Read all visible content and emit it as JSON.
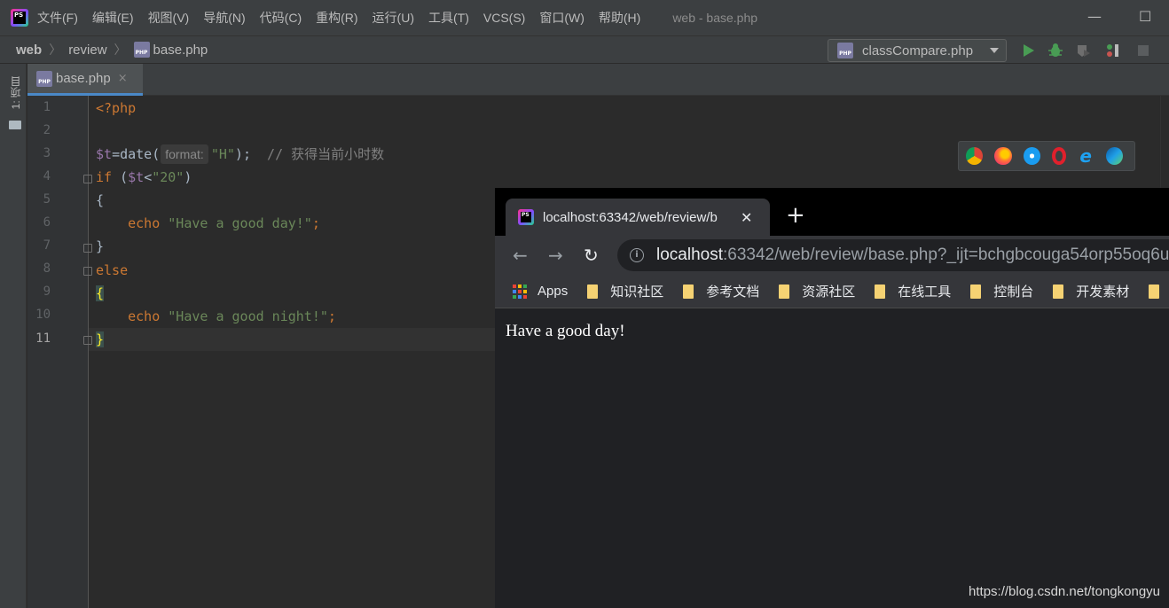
{
  "menubar": {
    "items": [
      "文件(F)",
      "编辑(E)",
      "视图(V)",
      "导航(N)",
      "代码(C)",
      "重构(R)",
      "运行(U)",
      "工具(T)",
      "VCS(S)",
      "窗口(W)",
      "帮助(H)"
    ],
    "window_title": "web - base.php",
    "minimize_glyph": "—",
    "maximize_glyph": "☐"
  },
  "navbar": {
    "project": "web",
    "folder": "review",
    "file": "base.php",
    "run_config": "classCompare.php"
  },
  "toolstrip": {
    "project_label": "1: 项目"
  },
  "editor": {
    "tab_label": "base.php",
    "tab_close": "×",
    "line_numbers": [
      "1",
      "2",
      "3",
      "4",
      "5",
      "6",
      "7",
      "8",
      "9",
      "10",
      "11"
    ],
    "lines": {
      "l1": "<?php",
      "l3_var": "$t",
      "l3_call": "=date(",
      "l3_hint": "format:",
      "l3_arg": "\"H\"",
      "l3_end": ");  ",
      "l3_comment": "// 获得当前小时数",
      "l4_if": "if",
      "l4_open": " (",
      "l4_var": "$t",
      "l4_lt": "<",
      "l4_val": "\"20\"",
      "l4_close": ")",
      "l5": "{",
      "l6_echo": "    echo ",
      "l6_str": "\"Have a good day!\"",
      "l6_semi": ";",
      "l7": "}",
      "l8": "else",
      "l9": "{",
      "l10_echo": "    echo ",
      "l10_str": "\"Have a good night!\"",
      "l10_semi": ";",
      "l11": "}"
    }
  },
  "browser_icons": [
    "chrome-icon",
    "firefox-icon",
    "safari-icon",
    "opera-icon",
    "ie-icon",
    "edge-icon"
  ],
  "browser": {
    "tab_title": "localhost:63342/web/review/b",
    "tab_close": "✕",
    "new_tab": "+",
    "back": "←",
    "forward": "→",
    "reload": "↻",
    "info": "i",
    "url_host": "localhost",
    "url_rest": ":63342/web/review/base.php?_ijt=bchgbcouga54orp55oq6u",
    "bookmarks": [
      "Apps",
      "知识社区",
      "参考文档",
      "资源社区",
      "在线工具",
      "控制台",
      "开发素材"
    ],
    "page_text": "Have a good day!",
    "watermark": "https://blog.csdn.net/tongkongyu"
  },
  "colors": {
    "accent": "#4a88c7",
    "keyword": "#cc7832",
    "string": "#6a8759",
    "variable": "#9876aa"
  }
}
